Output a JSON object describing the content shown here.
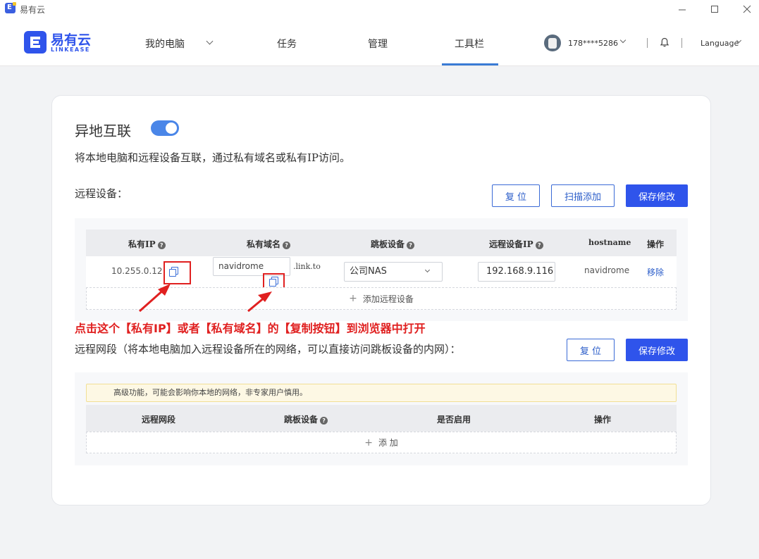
{
  "window": {
    "title": "易有云",
    "logo_letter": "E"
  },
  "brand": {
    "name": "易有云",
    "sub": "LINKEASE"
  },
  "nav": {
    "my_computer": "我的电脑",
    "tasks": "任务",
    "manage": "管理",
    "toolbar": "工具栏"
  },
  "user": {
    "name": "178****5286"
  },
  "language": "Language",
  "section": {
    "title": "异地互联",
    "enabled": true,
    "description": "将本地电脑和远程设备互联，通过私有域名或私有IP访问。"
  },
  "remote_devices": {
    "title": "远程设备：",
    "buttons": {
      "reset": "复 位",
      "scan_add": "扫描添加",
      "save": "保存修改"
    },
    "columns": [
      "私有IP",
      "私有域名",
      "跳板设备",
      "远程设备IP",
      "hostname",
      "操作"
    ],
    "rows": [
      {
        "private_ip": "10.255.0.12",
        "domain_prefix": "navidrome",
        "domain_suffix": ".link.to",
        "jump_device": "公司NAS",
        "remote_ip": "192.168.9.116",
        "hostname": "navidrome",
        "action": "移除"
      }
    ],
    "add_label": "添加远程设备"
  },
  "annotation": "点击这个【私有IP】或者【私有域名】的【复制按钮】到浏览器中打开",
  "remote_segments": {
    "title": "远程网段（将本地电脑加入远程设备所在的网络，可以直接访问跳板设备的内网）：",
    "buttons": {
      "reset": "复 位",
      "save": "保存修改"
    },
    "warning": "高级功能，可能会影响你本地的网络，非专家用户慎用。",
    "columns": [
      "远程网段",
      "跳板设备",
      "是否启用",
      "操作"
    ],
    "add_label": "添 加"
  },
  "colors": {
    "primary": "#2f54eb",
    "annotation": "#e02020",
    "toggle": "#4a86e8"
  }
}
